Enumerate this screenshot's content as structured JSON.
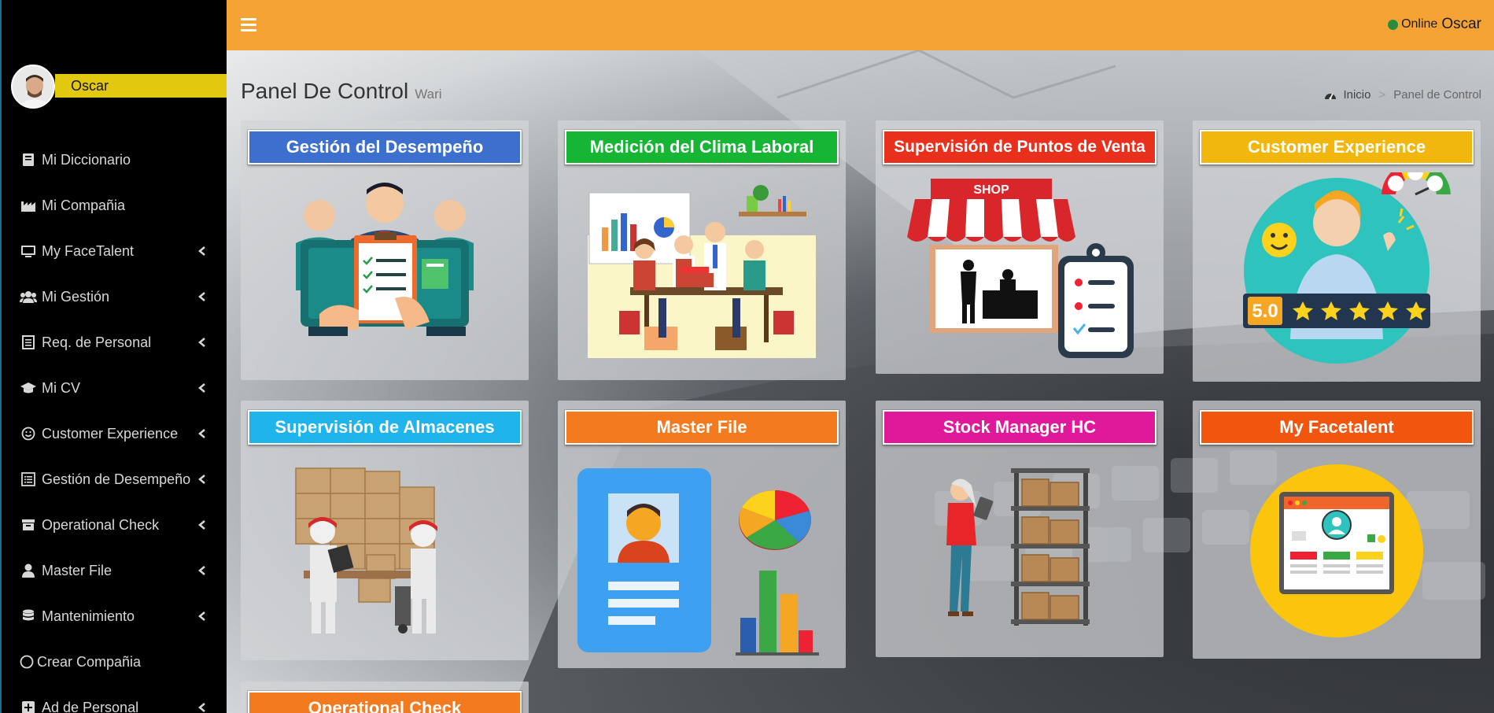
{
  "user": {
    "name": "Oscar"
  },
  "topbar": {
    "status": "Online",
    "username": "Oscar"
  },
  "sidebar": {
    "items": [
      {
        "label": "Mi Diccionario",
        "icon": "book-icon",
        "has_chevron": false
      },
      {
        "label": "Mi Compañia",
        "icon": "industry-icon",
        "has_chevron": false
      },
      {
        "label": "My FaceTalent",
        "icon": "tv-icon",
        "has_chevron": true
      },
      {
        "label": "Mi Gestión",
        "icon": "users-icon",
        "has_chevron": true
      },
      {
        "label": "Req. de Personal",
        "icon": "list-alt-icon",
        "has_chevron": true
      },
      {
        "label": "Mi CV",
        "icon": "graduation-cap-icon",
        "has_chevron": true
      },
      {
        "label": "Customer Experience",
        "icon": "smile-icon",
        "has_chevron": true
      },
      {
        "label": "Gestión de Desempeño",
        "icon": "list-icon",
        "has_chevron": true
      },
      {
        "label": "Operational Check",
        "icon": "archive-icon",
        "has_chevron": true
      },
      {
        "label": "Master File",
        "icon": "user-icon",
        "has_chevron": true
      },
      {
        "label": "Mantenimiento",
        "icon": "database-icon",
        "has_chevron": true
      },
      {
        "label": "Crear Compañia",
        "icon": "circle-icon",
        "has_chevron": false
      },
      {
        "label": "Ad de Personal",
        "icon": "plus-square-icon",
        "has_chevron": true
      }
    ]
  },
  "header": {
    "title": "Panel De Control",
    "subtitle": "Wari",
    "breadcrumb": {
      "home": "Inicio",
      "current": "Panel de Control"
    }
  },
  "cards": [
    {
      "title": "Gestión del Desempeño",
      "color": "#3d6fcf",
      "icon": "performance-review-illustration"
    },
    {
      "title": "Medición del Clima Laboral",
      "color": "#16b533",
      "icon": "team-meeting-illustration"
    },
    {
      "title": "Supervisión de Puntos de Venta",
      "color": "#e8301c",
      "icon": "shop-checklist-illustration"
    },
    {
      "title": "Customer Experience",
      "color": "#f2b70f",
      "icon": "customer-rating-illustration"
    },
    {
      "title": "Supervisión de Almacenes",
      "color": "#1fb4ec",
      "icon": "warehouse-boxes-illustration"
    },
    {
      "title": "Master File",
      "color": "#f47a1f",
      "icon": "profile-file-illustration"
    },
    {
      "title": "Stock Manager HC",
      "color": "#e0199a",
      "icon": "stock-shelf-illustration"
    },
    {
      "title": "My Facetalent",
      "color": "#f2560e",
      "icon": "profile-browser-illustration"
    },
    {
      "title": "Operational Check",
      "color": "#f47a1f",
      "icon": "operational-check-illustration"
    }
  ],
  "illustration_text": {
    "shop_sign": "SHOP",
    "rating": "5.0"
  },
  "colors": {
    "sidebar_bg": "#000000",
    "topbar_bg": "#f5a334",
    "user_bar": "#e2c80f",
    "online_dot": "#2b8a3e"
  }
}
